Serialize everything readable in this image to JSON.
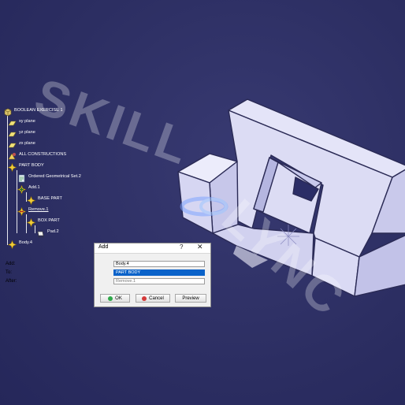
{
  "tree": {
    "items": [
      {
        "label": "BOOLEAN EXERCISE 1",
        "icon": "part-icon"
      },
      {
        "label": "xy plane",
        "icon": "plane-icon"
      },
      {
        "label": "yz plane",
        "icon": "plane-icon"
      },
      {
        "label": "zx plane",
        "icon": "plane-icon"
      },
      {
        "label": "ALL CONSTRUCTIONS",
        "icon": "geometrical-set-icon"
      },
      {
        "label": "PART BODY",
        "icon": "body-icon"
      },
      {
        "label": "Ordered Geometrical Set.2",
        "icon": "ordered-set-icon"
      },
      {
        "label": "Add.1",
        "icon": "add-icon"
      },
      {
        "label": "BASE PART",
        "icon": "body-icon"
      },
      {
        "label": "Remove.1",
        "icon": "remove-icon"
      },
      {
        "label": "BOX PART",
        "icon": "body-icon"
      },
      {
        "label": "Pad.2",
        "icon": "pad-icon"
      },
      {
        "label": "Body.4",
        "icon": "body-icon"
      }
    ]
  },
  "dialog": {
    "title": "Add",
    "help_label": "?",
    "close_label": "✕",
    "add_label": "Add:",
    "add_value": "Body.4",
    "to_label": "To:",
    "to_value": "PART BODY",
    "after_label": "After:",
    "after_value": "Remove.1",
    "ok_label": "OK",
    "cancel_label": "Cancel",
    "preview_label": "Preview"
  },
  "watermark": {
    "line1": "SKILL",
    "line2": "LYNC"
  },
  "colors": {
    "background": "#2c2e62",
    "model_face": "#d9d9f3",
    "selection": "#0a62c9"
  }
}
